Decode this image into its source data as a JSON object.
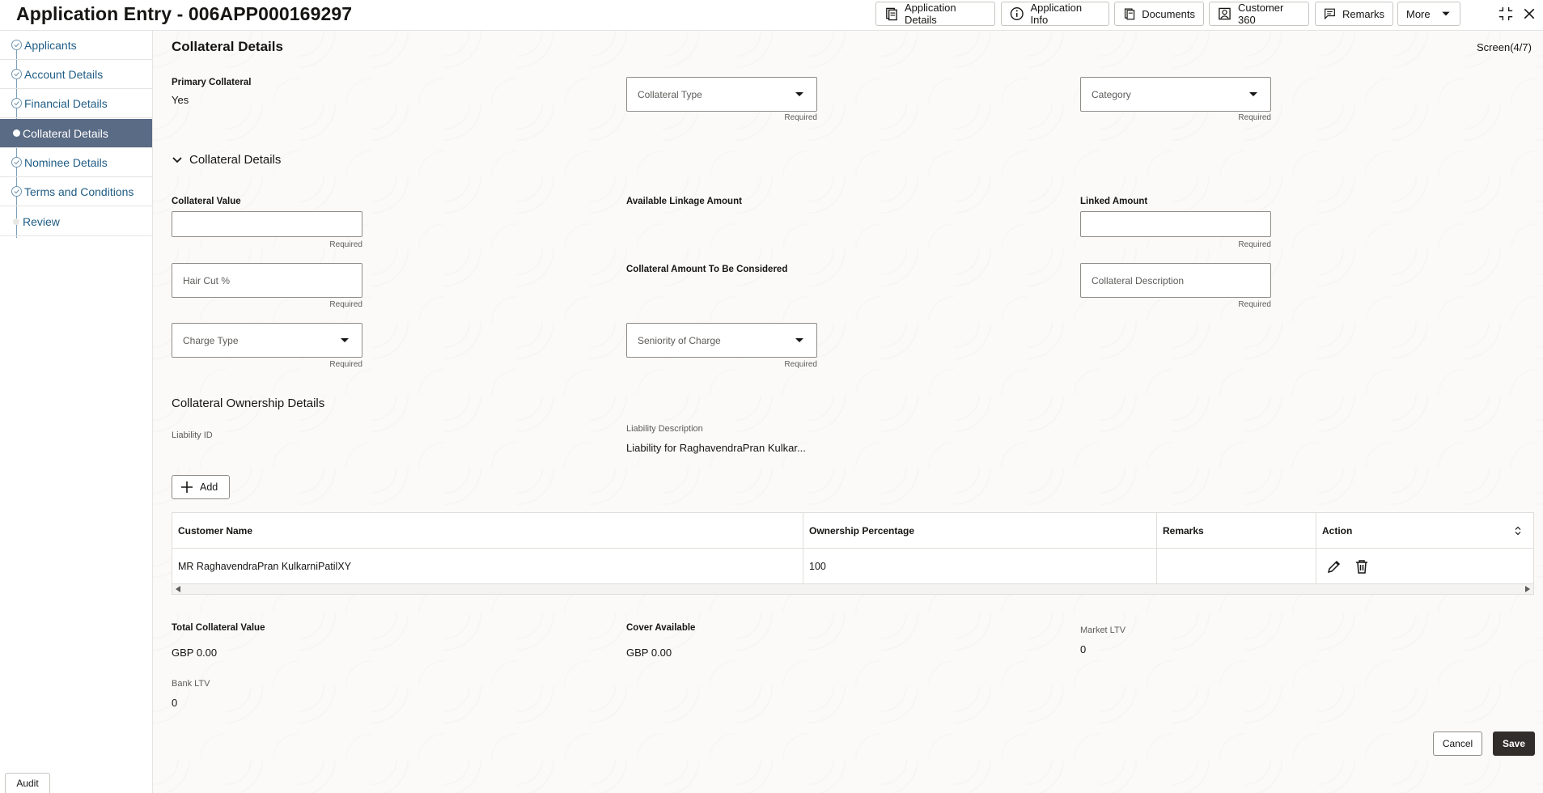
{
  "header": {
    "title": "Application Entry - 006APP000169297",
    "buttons": [
      {
        "label": "Application Details",
        "icon": "document-icon"
      },
      {
        "label": "Application Info",
        "icon": "info-icon"
      },
      {
        "label": "Documents",
        "icon": "documents-icon"
      },
      {
        "label": "Customer 360",
        "icon": "person-icon"
      },
      {
        "label": "Remarks",
        "icon": "comment-icon"
      },
      {
        "label": "More",
        "icon": "caret-down-icon"
      }
    ]
  },
  "sidebar": {
    "items": [
      {
        "label": "Applicants",
        "state": "done"
      },
      {
        "label": "Account Details",
        "state": "done"
      },
      {
        "label": "Financial Details",
        "state": "done"
      },
      {
        "label": "Collateral Details",
        "state": "active"
      },
      {
        "label": "Nominee Details",
        "state": "done"
      },
      {
        "label": "Terms and Conditions",
        "state": "done"
      },
      {
        "label": "Review",
        "state": "pending"
      }
    ],
    "audit_label": "Audit"
  },
  "main": {
    "title": "Collateral Details",
    "screen_indicator": "Screen(4/7)",
    "primary_collateral": {
      "label": "Primary Collateral",
      "value": "Yes"
    },
    "collateral_type": {
      "placeholder": "Collateral Type",
      "hint": "Required"
    },
    "category": {
      "placeholder": "Category",
      "hint": "Required"
    },
    "collateral_section_title": "Collateral Details",
    "collateral_value": {
      "label": "Collateral Value",
      "hint": "Required"
    },
    "available_linkage_amount": {
      "label": "Available Linkage Amount"
    },
    "linked_amount": {
      "label": "Linked Amount",
      "hint": "Required"
    },
    "hair_cut": {
      "placeholder": "Hair Cut %",
      "hint": "Required"
    },
    "collateral_amount_considered": {
      "label": "Collateral Amount To Be Considered"
    },
    "collateral_description": {
      "placeholder": "Collateral Description",
      "hint": "Required"
    },
    "charge_type": {
      "placeholder": "Charge Type",
      "hint": "Required"
    },
    "seniority_of_charge": {
      "placeholder": "Seniority of Charge",
      "hint": "Required"
    },
    "ownership_title": "Collateral Ownership Details",
    "liability_id": {
      "label": "Liability ID"
    },
    "liability_description": {
      "label": "Liability Description",
      "value": "Liability for RaghavendraPran Kulkar..."
    },
    "add_label": "Add",
    "table": {
      "headers": [
        "Customer Name",
        "Ownership Percentage",
        "Remarks",
        "Action"
      ],
      "rows": [
        {
          "customer_name": "MR RaghavendraPran KulkarniPatilXY",
          "ownership_percentage": "100",
          "remarks": ""
        }
      ]
    },
    "summary": {
      "total_collateral_value": {
        "label": "Total Collateral Value",
        "value": "GBP 0.00"
      },
      "cover_available": {
        "label": "Cover Available",
        "value": "GBP 0.00"
      },
      "market_ltv": {
        "label": "Market LTV",
        "value": "0"
      },
      "bank_ltv": {
        "label": "Bank LTV",
        "value": "0"
      }
    },
    "cancel_label": "Cancel",
    "save_label": "Save"
  }
}
